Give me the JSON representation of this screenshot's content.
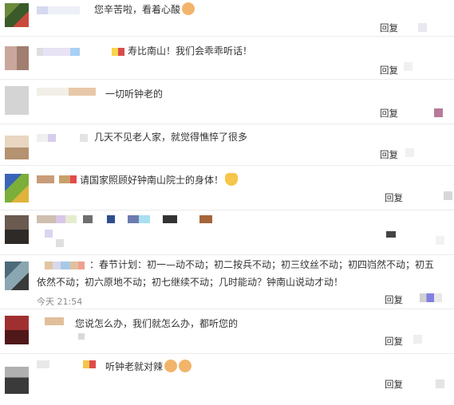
{
  "comments": [
    {
      "text": "您辛苦啦，看着心酸",
      "reply": "回复"
    },
    {
      "text": "寿比南山！我们会乖乖听话！",
      "reply": "回复"
    },
    {
      "text": "一切听钟老的",
      "reply": "回复"
    },
    {
      "text": "几天不见老人家，就觉得憔悴了很多",
      "reply": "回复"
    },
    {
      "text": "请国家照顾好钟南山院士的身体！",
      "reply": "回复"
    },
    {
      "text": "",
      "reply": ""
    },
    {
      "text_line1": "：春节计划：初一—动不动；初二按兵不动；初三纹丝不动；初四岿然不动；初五",
      "text_line2": "依然不动；初六原地不动；初七继续不动；几时能动？钟南山说动才动！",
      "time": "今天 21:54",
      "reply": "回复"
    },
    {
      "text": "您说怎么办，我们就怎么办，都听您的",
      "reply": "回复"
    },
    {
      "text": "听钟老就对辣",
      "reply": "回复"
    }
  ],
  "icons": [
    "cry-emoji-icon",
    "folded-hands-emoji-icon",
    "baby-emoji-icon",
    "like-icon"
  ]
}
